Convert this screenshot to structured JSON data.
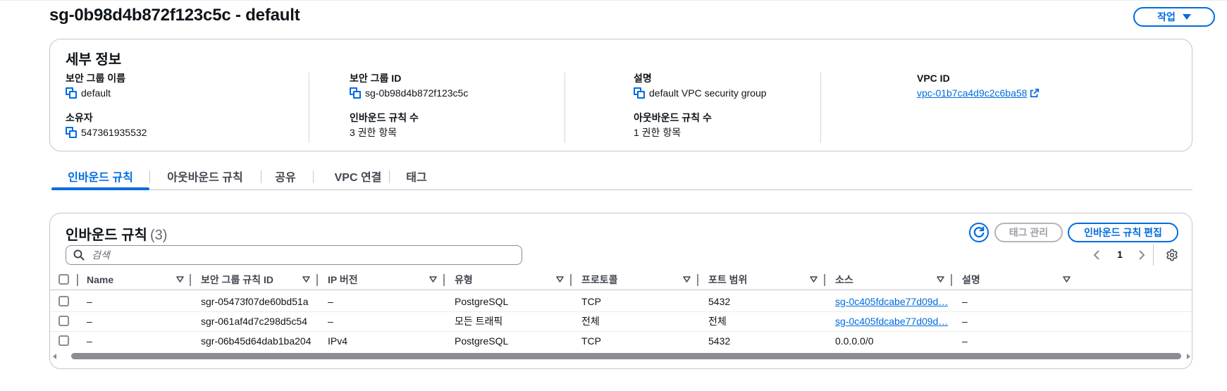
{
  "header": {
    "title": "sg-0b98d4b872f123c5c - default",
    "actions_label": "작업"
  },
  "details": {
    "title": "세부 정보",
    "fields": {
      "sg_name": {
        "label": "보안 그룹 이름",
        "value": "default"
      },
      "sg_id": {
        "label": "보안 그룹 ID",
        "value": "sg-0b98d4b872f123c5c"
      },
      "description": {
        "label": "설명",
        "value": "default VPC security group"
      },
      "vpc_id": {
        "label": "VPC ID",
        "value": "vpc-01b7ca4d9c2c6ba58"
      },
      "owner": {
        "label": "소유자",
        "value": "547361935532"
      },
      "inbound_count": {
        "label": "인바운드 규칙 수",
        "value": "3 권한 항목"
      },
      "outbound_count": {
        "label": "아웃바운드 규칙 수",
        "value": "1 권한 항목"
      }
    }
  },
  "tabs": [
    {
      "label": "인바운드 규칙",
      "active": true
    },
    {
      "label": "아웃바운드 규칙",
      "active": false
    },
    {
      "label": "공유",
      "active": false
    },
    {
      "label": "VPC 연결",
      "active": false
    },
    {
      "label": "태그",
      "active": false
    }
  ],
  "rules": {
    "title": "인바운드 규칙",
    "count": "(3)",
    "manage_tags_label": "태그 관리",
    "edit_label": "인바운드 규칙 편집",
    "search_placeholder": "검색",
    "page": "1",
    "columns": [
      "Name",
      "보안 그룹 규칙 ID",
      "IP 버전",
      "유형",
      "프로토콜",
      "포트 범위",
      "소스",
      "설명"
    ],
    "rows": [
      {
        "name": "–",
        "rule_id": "sgr-05473f07de60bd51a",
        "ip_version": "–",
        "type": "PostgreSQL",
        "protocol": "TCP",
        "port_range": "5432",
        "source": "sg-0c405fdcabe77d09d…",
        "source_is_link": true,
        "description": "–"
      },
      {
        "name": "–",
        "rule_id": "sgr-061af4d7c298d5c54",
        "ip_version": "–",
        "type": "모든 트래픽",
        "protocol": "전체",
        "port_range": "전체",
        "source": "sg-0c405fdcabe77d09d…",
        "source_is_link": true,
        "description": "–"
      },
      {
        "name": "–",
        "rule_id": "sgr-06b45d64dab1ba204",
        "ip_version": "IPv4",
        "type": "PostgreSQL",
        "protocol": "TCP",
        "port_range": "5432",
        "source": "0.0.0.0/0",
        "source_is_link": false,
        "description": "–"
      }
    ]
  },
  "icons": {
    "copy": "copy-icon",
    "external_link": "external-link-icon",
    "caret_down": "caret-down-icon",
    "refresh": "refresh-icon",
    "search": "search-icon",
    "sort": "sort-icon",
    "settings": "gear-icon",
    "prev": "chevron-left-icon",
    "next": "chevron-right-icon"
  },
  "colors": {
    "accent": "#006ce0",
    "text": "#0f141a",
    "muted": "#656871",
    "border": "#c6c6cd",
    "disabled": "#9ba0a6"
  }
}
